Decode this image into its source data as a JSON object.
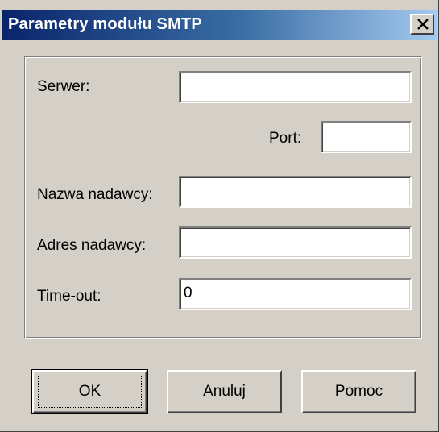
{
  "window": {
    "title": "Parametry modułu SMTP",
    "close_icon": "close-icon"
  },
  "form": {
    "server": {
      "label": "Serwer:",
      "value": ""
    },
    "port": {
      "label": "Port:",
      "value": ""
    },
    "sender_name": {
      "label": "Nazwa nadawcy:",
      "value": ""
    },
    "sender_address": {
      "label": "Adres nadawcy:",
      "value": ""
    },
    "timeout": {
      "label": "Time-out:",
      "value": "0"
    }
  },
  "buttons": {
    "ok": "OK",
    "cancel": "Anuluj",
    "help_first": "P",
    "help_rest": "omoc"
  },
  "colors": {
    "title_start": "#0a246a",
    "title_end": "#a6caf0",
    "face": "#d4d0c8"
  }
}
